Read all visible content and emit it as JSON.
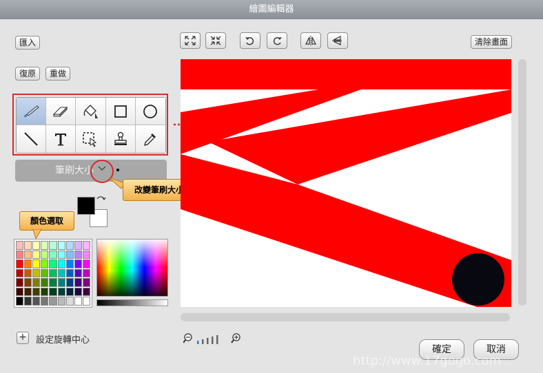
{
  "window": {
    "title": "繪圖編輯器"
  },
  "left": {
    "import_label": "匯入",
    "undo_label": "復原",
    "redo_label": "重做",
    "brush_size_label": "筆刷大小",
    "set_rotation_center_label": "設定旋轉中心"
  },
  "toolbar": {
    "clear_label": "清除畫面"
  },
  "tools": [
    "brush-icon",
    "eraser-icon",
    "fill-bucket-icon",
    "rectangle-icon",
    "ellipse-icon",
    "line-icon",
    "text-icon",
    "select-icon",
    "stamp-icon",
    "eyedropper-icon"
  ],
  "annotations": {
    "brush_size_callout": "改變筆刷大小",
    "color_callout": "顏色選取"
  },
  "colors": {
    "foreground": "#000000",
    "background": "#ffffff",
    "canvas_red": "#ff0000",
    "canvas_circle": "#080810",
    "highlight": "#d62a2a"
  },
  "palette": [
    "#ffbdbd",
    "#ffd9b3",
    "#ffffb3",
    "#d9ffb3",
    "#b3ffd9",
    "#b3ffff",
    "#b3d9ff",
    "#d9b3ff",
    "#ffb3ff",
    "#ff8080",
    "#ffbf80",
    "#ffff80",
    "#bfff80",
    "#80ffbf",
    "#80ffff",
    "#80bfff",
    "#bf80ff",
    "#ff80ff",
    "#ff0000",
    "#ff8000",
    "#ffff00",
    "#80ff00",
    "#00ff80",
    "#00ffff",
    "#0080ff",
    "#8000ff",
    "#ff00ff",
    "#c00000",
    "#c06000",
    "#c0c000",
    "#60c000",
    "#00c060",
    "#00c0c0",
    "#0060c0",
    "#6000c0",
    "#c000c0",
    "#800000",
    "#804000",
    "#808000",
    "#408000",
    "#008040",
    "#008080",
    "#004080",
    "#400080",
    "#800080",
    "#400000",
    "#402000",
    "#404000",
    "#204000",
    "#004020",
    "#004040",
    "#002040",
    "#200040",
    "#400040",
    "#000000",
    "#333333",
    "#555555",
    "#777777",
    "#999999",
    "#bbbbbb",
    "#dddddd",
    "#ffffff",
    "#ffffff"
  ],
  "actions": {
    "ok_label": "確定",
    "cancel_label": "取消"
  },
  "watermark": "http://www.17gogo.com"
}
